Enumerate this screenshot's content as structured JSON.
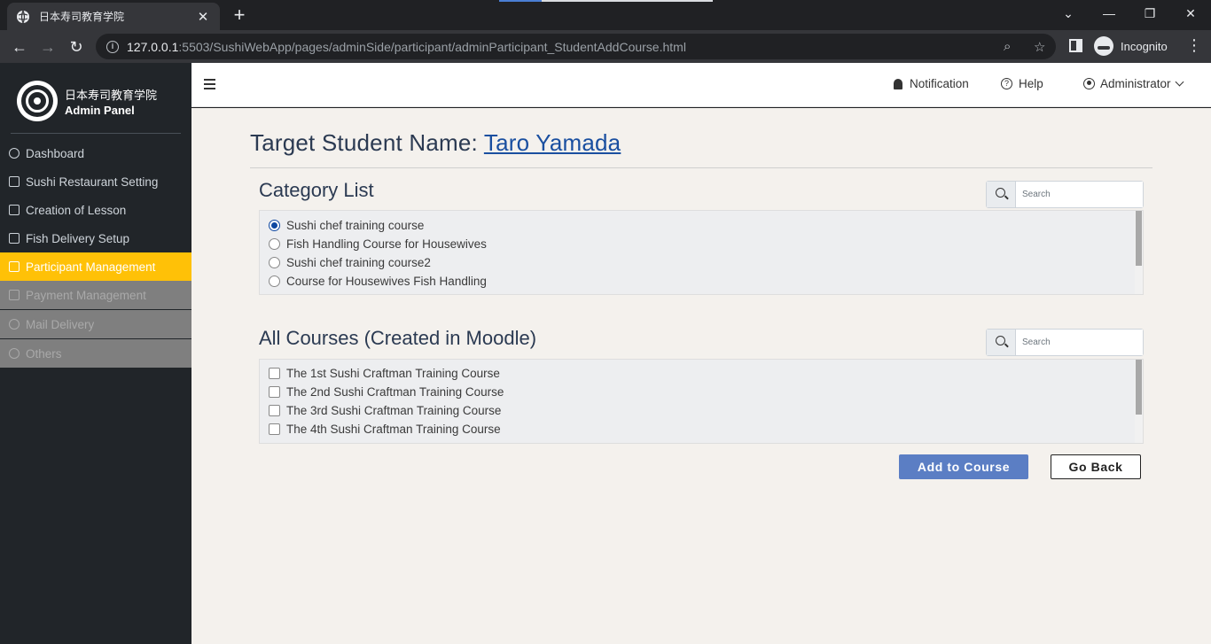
{
  "browser": {
    "tab_title": "日本寿司教育学院",
    "tab_close": "✕",
    "new_tab": "+",
    "url_host": "127.0.0.1",
    "url_rest": ":5503/SushiWebApp/pages/adminSide/participant/adminParticipant_StudentAddCourse.html",
    "incognito_label": "Incognito",
    "win_min": "—",
    "win_restore": "❐",
    "win_close": "✕"
  },
  "sidebar": {
    "brand_jp": "日本寿司教育学院",
    "brand_en": "Admin Panel",
    "items": [
      {
        "label": "Dashboard"
      },
      {
        "label": "Sushi Restaurant Setting"
      },
      {
        "label": "Creation of Lesson"
      },
      {
        "label": "Fish Delivery Setup"
      },
      {
        "label": "Participant Management"
      },
      {
        "label": "Payment Management"
      },
      {
        "label": "Mail Delivery"
      },
      {
        "label": "Others"
      }
    ]
  },
  "header": {
    "notification": "Notification",
    "help": "Help",
    "user": "Administrator"
  },
  "page": {
    "title_prefix": "Target Student Name: ",
    "student_name": "Taro Yamada"
  },
  "category_list": {
    "title": "Category List",
    "search_placeholder": "Search",
    "items": [
      "Sushi chef training course",
      "Fish Handling Course for Housewives",
      "Sushi chef training course2",
      "Course for Housewives Fish Handling"
    ],
    "selected_index": 0
  },
  "courses": {
    "title": "All Courses (Created in Moodle)",
    "search_placeholder": "Search",
    "items": [
      "The 1st Sushi Craftman Training Course",
      "The 2nd Sushi Craftman Training Course",
      "The 3rd Sushi Craftman Training Course",
      "The 4th Sushi Craftman Training Course"
    ]
  },
  "actions": {
    "add": "Add to Course",
    "back": "Go Back"
  },
  "colors": {
    "sidebar_bg": "#212529",
    "active_menu": "#ffc107",
    "primary_button": "#5b7ec4",
    "main_bg": "#f4f1ed"
  }
}
